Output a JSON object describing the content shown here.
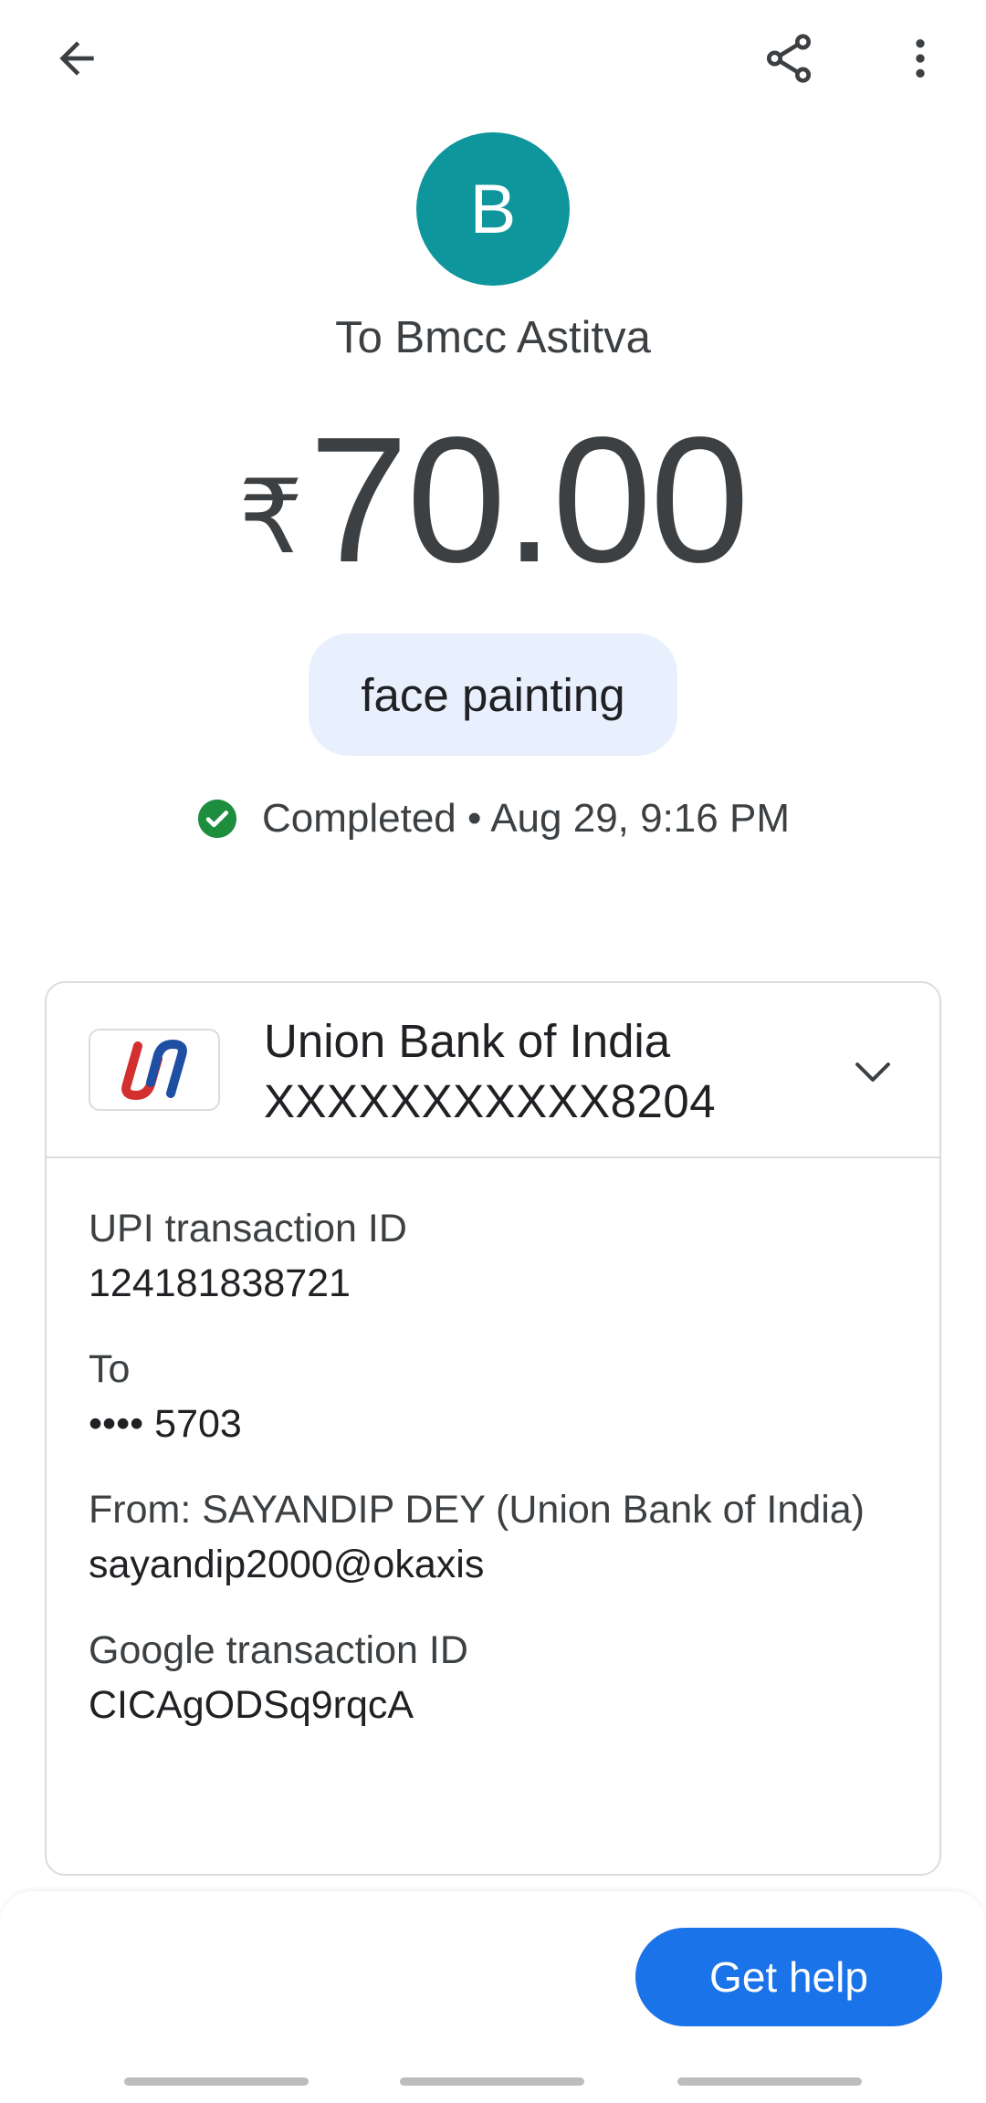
{
  "header": {
    "back_icon": "arrow-back-icon",
    "share_icon": "share-icon",
    "more_icon": "more-vert-icon"
  },
  "payee": {
    "avatar_letter": "B",
    "avatar_color": "#0f969c",
    "title": "To Bmcc Astitva"
  },
  "payment": {
    "currency_symbol": "₹",
    "amount": "70.00",
    "note": "face painting",
    "status": "Completed • Aug 29, 9:16 PM",
    "status_color": "#1e8e3e"
  },
  "bank": {
    "name": "Union Bank of India",
    "account": "XXXXXXXXXXX8204"
  },
  "details": {
    "upi_label": "UPI transaction ID",
    "upi_value": "124181838721",
    "to_label": "To",
    "to_value": "•••• 5703",
    "from_label": "From: SAYANDIP DEY (Union Bank of India)",
    "from_value": "sayandip2000@okaxis",
    "google_label": "Google transaction ID",
    "google_value": "CICAgODSq9rqcA"
  },
  "actions": {
    "help_label": "Get help",
    "accent_color": "#1a73e8"
  }
}
